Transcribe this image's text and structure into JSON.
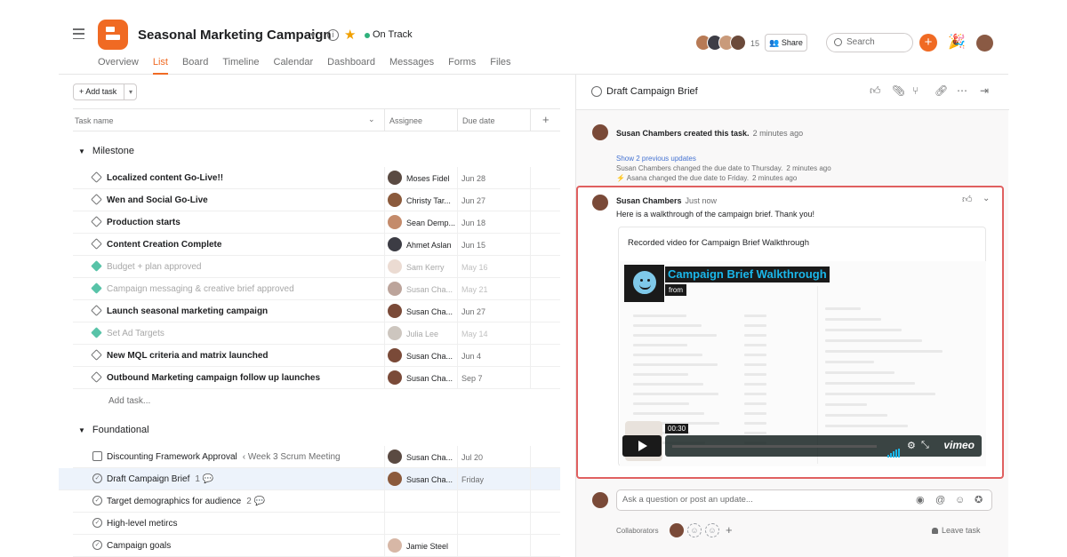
{
  "header": {
    "project_title": "Seasonal Marketing Campaign",
    "status": "On Track",
    "status_color": "#2fb17c",
    "accent": "#f06a23",
    "tabs": [
      "Overview",
      "List",
      "Board",
      "Timeline",
      "Calendar",
      "Dashboard",
      "Messages",
      "Forms",
      "Files"
    ],
    "active_tab": "List",
    "member_count": "15",
    "share_label": "Share",
    "search_label": "Search"
  },
  "list": {
    "add_task_label": "+ Add task",
    "columns": [
      "Task name",
      "Assignee",
      "Due date"
    ],
    "sections": [
      {
        "name": "Milestone"
      },
      {
        "name": "Foundational"
      }
    ],
    "milestone_rows": [
      {
        "name": "Localized content Go-Live!!",
        "assignee": "Moses Fidel",
        "due": "Jun 28",
        "done": false
      },
      {
        "name": "Wen and Social Go-Live",
        "assignee": "Christy Tar...",
        "due": "Jun 27",
        "done": false
      },
      {
        "name": "Production starts",
        "assignee": "Sean Demp...",
        "due": "Jun 18",
        "done": false
      },
      {
        "name": "Content Creation Complete",
        "assignee": "Ahmet Aslan",
        "due": "Jun 15",
        "done": false
      },
      {
        "name": "Budget + plan approved",
        "assignee": "Sam Kerry",
        "due": "May 16",
        "done": true
      },
      {
        "name": "Campaign messaging & creative brief approved",
        "assignee": "Susan Cha...",
        "due": "May 21",
        "done": true
      },
      {
        "name": "Launch seasonal marketing campaign",
        "assignee": "Susan Cha...",
        "due": "Jun 27",
        "done": false
      },
      {
        "name": "Set Ad Targets",
        "assignee": "Julia Lee",
        "due": "May 14",
        "done": true
      },
      {
        "name": "New MQL criteria and matrix launched",
        "assignee": "Susan Cha...",
        "due": "Jun 4",
        "done": false
      },
      {
        "name": "Outbound Marketing campaign follow up launches",
        "assignee": "Susan Cha...",
        "due": "Sep 7",
        "done": false
      }
    ],
    "add_task_link": "Add task...",
    "foundational_rows": [
      {
        "name": "Discounting Framework Approval",
        "sub": "‹ Week 3 Scrum Meeting",
        "assignee": "Susan Cha...",
        "due": "Jul 20"
      },
      {
        "name": "Draft Campaign Brief",
        "sub": "1 💬",
        "assignee": "Susan Cha...",
        "due": "Friday"
      },
      {
        "name": "Target demographics for audience",
        "sub": "2 💬",
        "assignee": "",
        "due": ""
      },
      {
        "name": "High-level metircs",
        "sub": "",
        "assignee": "",
        "due": ""
      },
      {
        "name": "Campaign goals",
        "sub": "",
        "assignee": "Jamie Steel",
        "due": ""
      }
    ]
  },
  "detail": {
    "task_title": "Draft Campaign Brief",
    "created_by": "Susan Chambers created this task.",
    "created_time": "2 minutes ago",
    "show_updates": "Show 2 previous updates",
    "update1_name": "Susan Chambers",
    "update1_text": "changed the due date to Thursday.",
    "update1_time": "2 minutes ago",
    "update2_name": "Asana",
    "update2_text": "changed the due date to Friday.",
    "update2_time": "2 minutes ago",
    "comment_author": "Susan Chambers",
    "comment_time": "Just now",
    "comment_text": "Here is a walkthrough of the campaign brief. Thank you!",
    "video_card_title": "Recorded video for Campaign Brief Walkthrough",
    "video_title": "Campaign Brief Walkthrough",
    "video_from": "from",
    "video_time": "00:30",
    "video_brand": "vimeo",
    "post_placeholder": "Ask a question or post an update...",
    "collaborators_label": "Collaborators",
    "leave_task": "Leave task"
  }
}
